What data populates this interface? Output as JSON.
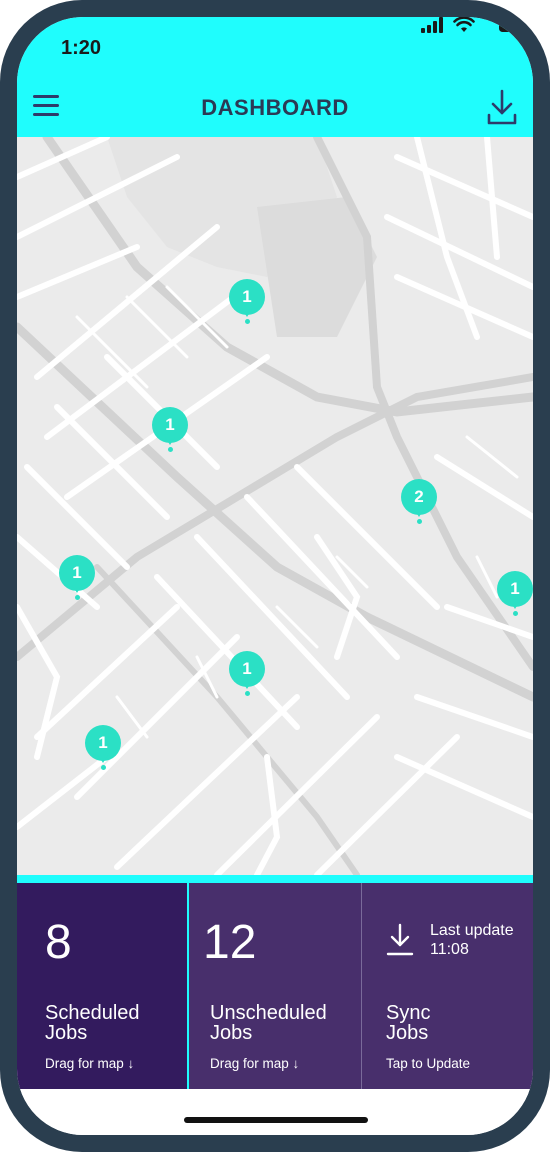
{
  "status_bar": {
    "time": "1:20",
    "icons": [
      "signal-icon",
      "wifi-icon",
      "battery-icon"
    ]
  },
  "header": {
    "title": "DASHBOARD",
    "menu_icon": "hamburger-menu-icon",
    "download_icon": "download-icon"
  },
  "map": {
    "markers": [
      {
        "count": "1"
      },
      {
        "count": "1"
      },
      {
        "count": "2"
      },
      {
        "count": "1"
      },
      {
        "count": "1"
      },
      {
        "count": "1"
      },
      {
        "count": "1"
      }
    ]
  },
  "tiles": {
    "scheduled": {
      "count": "8",
      "label_line1": "Scheduled",
      "label_line2": "Jobs",
      "hint": "Drag for map ↓"
    },
    "unscheduled": {
      "count": "12",
      "label_line1": "Unscheduled",
      "label_line2": "Jobs",
      "hint": "Drag for map ↓"
    },
    "sync": {
      "last_update_label": "Last update",
      "last_update_time": "11:08",
      "label_line1": "Sync",
      "label_line2": "Jobs",
      "hint": "Tap to Update"
    }
  },
  "colors": {
    "header_bg": "#1ffdfd",
    "marker": "#2be0c5",
    "tile_dark": "#331b5e",
    "tile_mid": "#482f6c",
    "phone_frame": "#2a3e4f"
  }
}
